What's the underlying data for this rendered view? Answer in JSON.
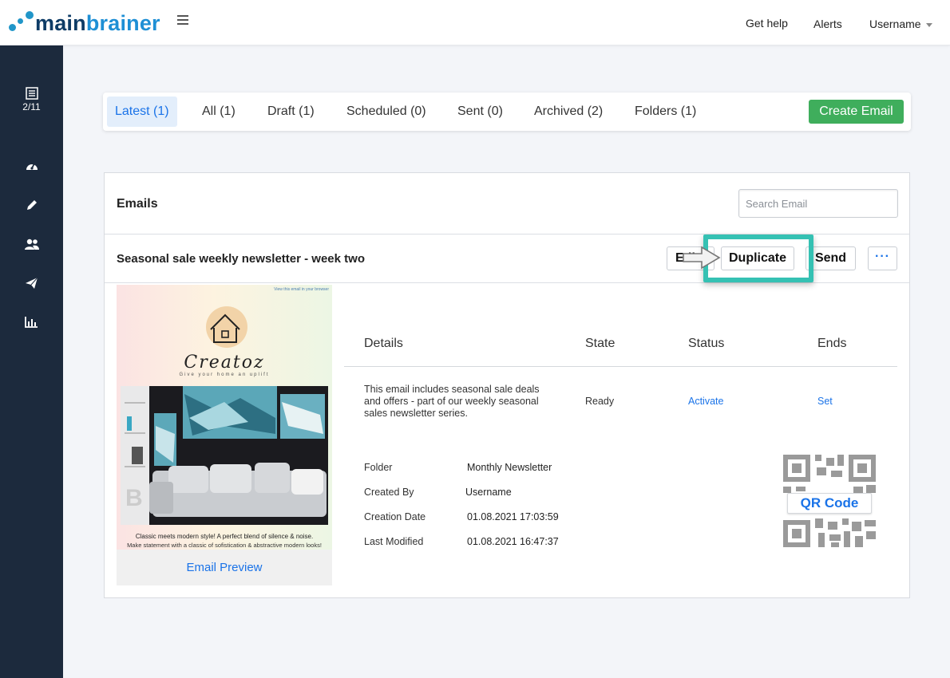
{
  "brand": {
    "main": "main",
    "brainer": "brainer"
  },
  "topnav": {
    "help": "Get help",
    "alerts": "Alerts",
    "user": "Username"
  },
  "sidebar": {
    "counter": "2/11"
  },
  "tabs": [
    {
      "label": "Latest (1)"
    },
    {
      "label": "All (1)"
    },
    {
      "label": "Draft (1)"
    },
    {
      "label": "Scheduled (0)"
    },
    {
      "label": "Sent (0)"
    },
    {
      "label": "Archived (2)"
    },
    {
      "label": "Folders (1)"
    }
  ],
  "create_button": "Create Email",
  "emails": {
    "title": "Emails",
    "search_placeholder": "Search Email"
  },
  "email": {
    "name": "Seasonal sale weekly newsletter - week two",
    "actions": {
      "edit": "Edit",
      "duplicate": "Duplicate",
      "send": "Send",
      "more": "···"
    },
    "preview": {
      "view_link": "View this email in your browser",
      "brand": "Creatoz",
      "tagline": "Give your home an uplift",
      "promo_line1": "Classic meets modern style! A perfect blend of silence & noise.",
      "promo_line2": "Make statement with a classic of sofistication & abstractive modern looks!",
      "link": "Email Preview"
    },
    "headers": {
      "details": "Details",
      "state": "State",
      "status": "Status",
      "ends": "Ends"
    },
    "details_text": "This email includes seasonal sale deals and offers - part of our weekly seasonal sales newsletter series.",
    "state": "Ready",
    "status_link": "Activate",
    "ends_link": "Set",
    "meta": {
      "folder_label": "Folder",
      "folder": "Monthly Newsletter",
      "created_by_label": "Created By",
      "created_by": "Username",
      "creation_label": "Creation Date",
      "creation": "01.08.2021 17:03:59",
      "modified_label": "Last Modified",
      "modified": "01.08.2021 16:47:37"
    },
    "qr_label": "QR Code"
  },
  "colors": {
    "accent": "#1a73e8",
    "create": "#3fae5c",
    "sidebar": "#1c2a3d",
    "highlight": "#35c1b3"
  }
}
